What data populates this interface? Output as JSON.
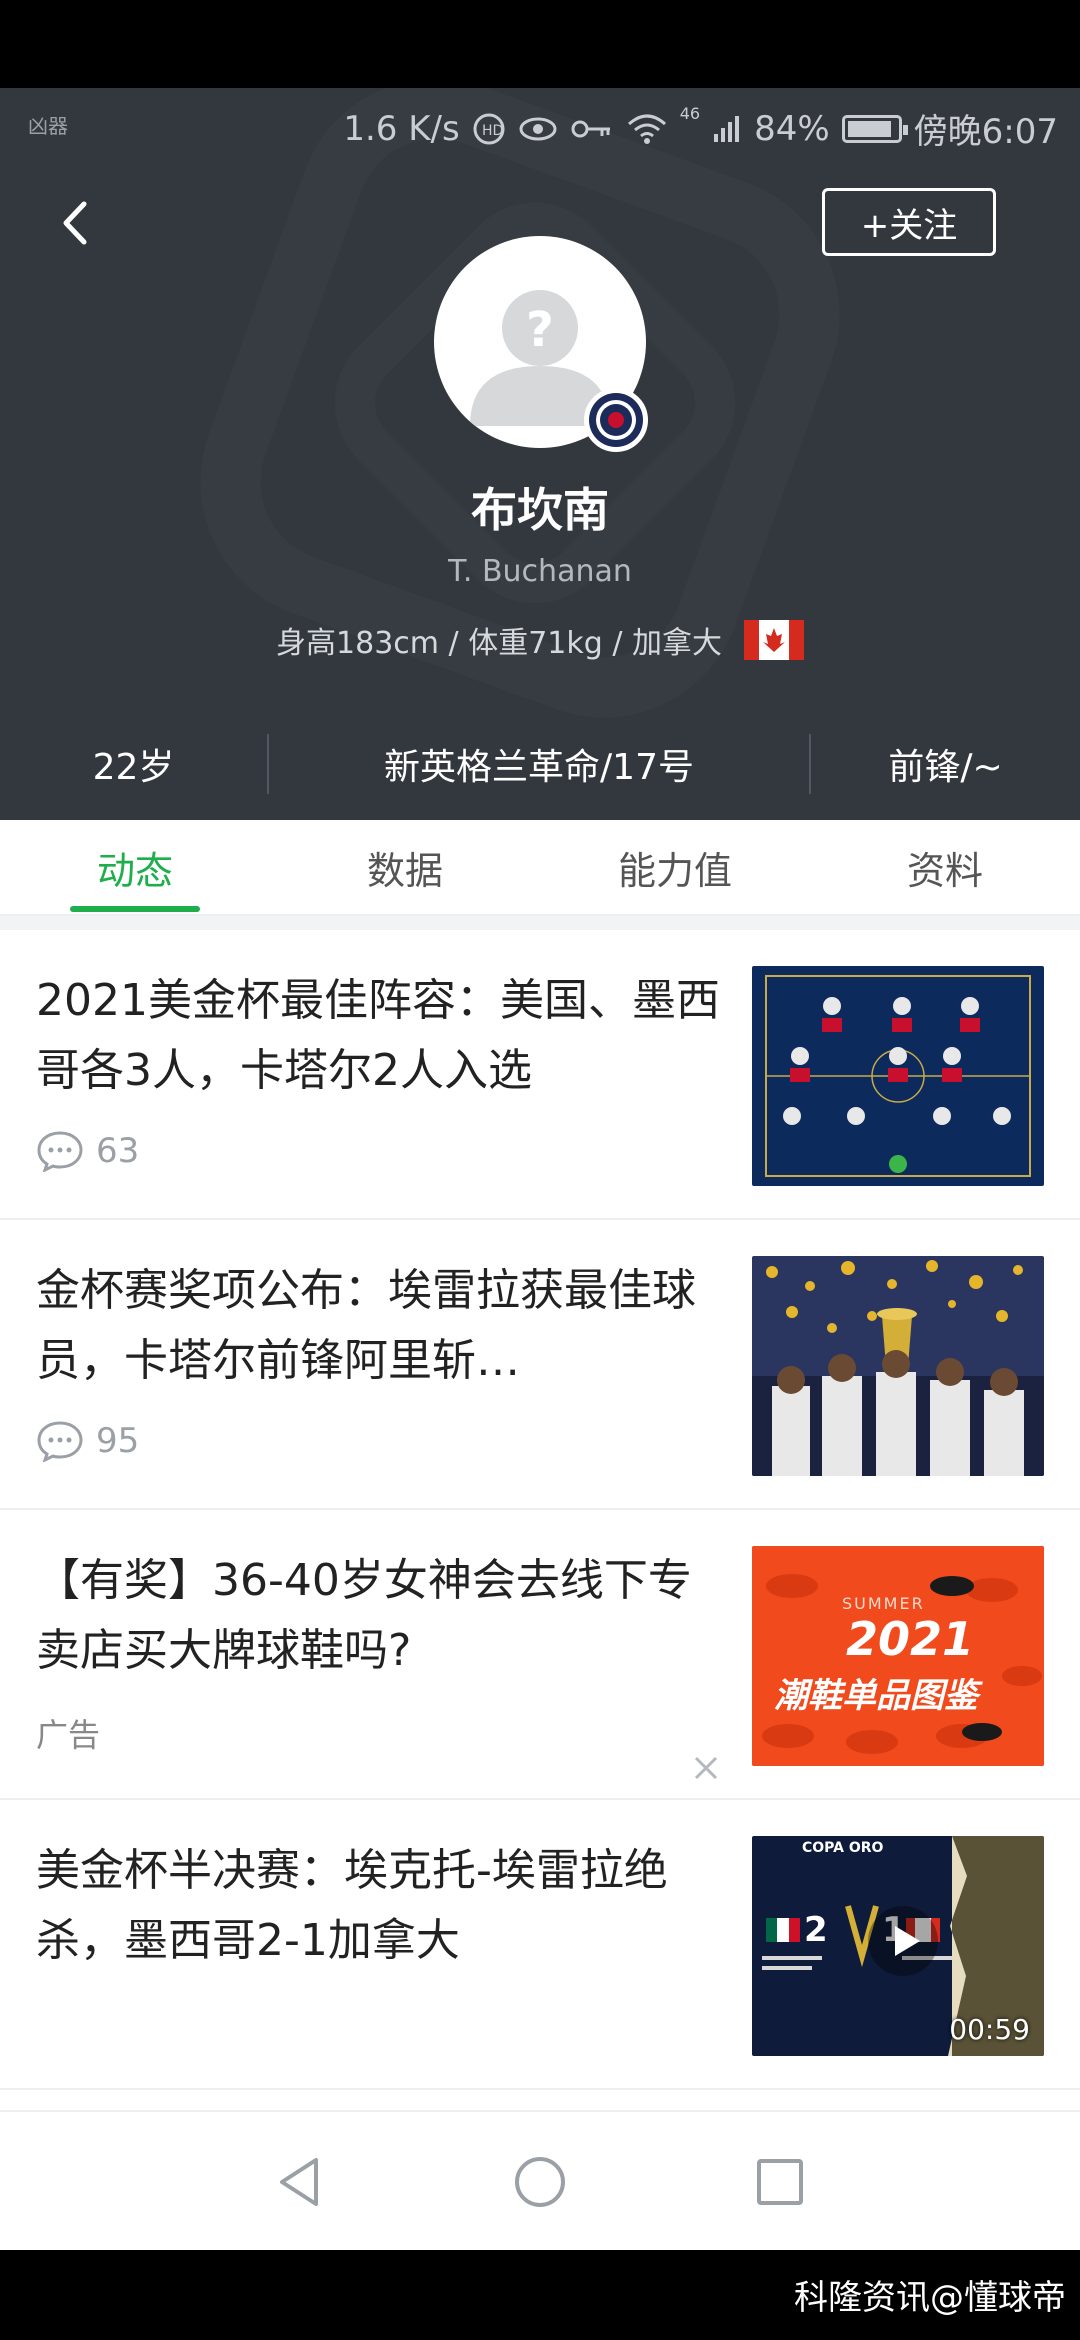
{
  "status_bar": {
    "left_glyph": "凶器",
    "speed": "1.6 K/s",
    "network": "46",
    "battery": "84%",
    "time": "傍晚6:07"
  },
  "header": {
    "follow_label": "+关注",
    "name": "布坎南",
    "name_en": "T. Buchanan",
    "stats": "身高183cm / 体重71kg / 加拿大",
    "age": "22岁",
    "club": "新英格兰革命/17号",
    "position": "前锋/~"
  },
  "tabs": [
    {
      "label": "动态",
      "active": true
    },
    {
      "label": "数据",
      "active": false
    },
    {
      "label": "能力值",
      "active": false
    },
    {
      "label": "资料",
      "active": false
    }
  ],
  "feed": [
    {
      "title": "2021美金杯最佳阵容：美国、墨西哥各3人，卡塔尔2人入选",
      "comments": "63",
      "thumb_icon": "lineup-thumbnail"
    },
    {
      "title": "金杯赛奖项公布：埃雷拉获最佳球员，卡塔尔前锋阿里斩…",
      "comments": "95",
      "thumb_icon": "trophy-celebration-thumbnail"
    },
    {
      "title": "【有奖】36-40岁女神会去线下专卖店买大牌球鞋吗?",
      "ad_label": "广告",
      "thumb_year": "2021",
      "thumb_caption": "潮鞋单品图鉴",
      "thumb_summer": "SUMMER"
    },
    {
      "title": "美金杯半决赛：埃克托-埃雷拉绝杀，墨西哥2-1加拿大",
      "duration": "00:59",
      "thumb_score_left": "2",
      "thumb_score_right": "1",
      "thumb_brand": "COPA ORO"
    }
  ],
  "watermark": "科隆资讯@懂球帝",
  "colors": {
    "accent": "#1fae4b",
    "header_bg": "#33383e"
  }
}
